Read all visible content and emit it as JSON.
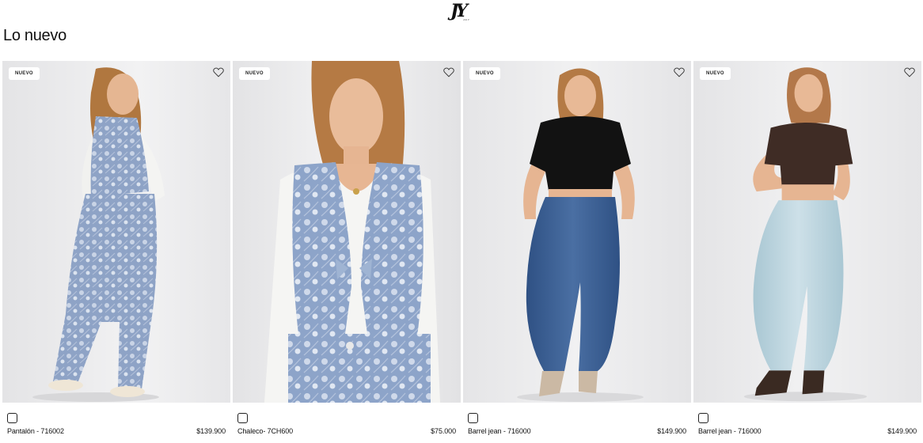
{
  "header": {
    "logo_text": "JY",
    "logo_sub": "JOY"
  },
  "section": {
    "title": "Lo nuevo"
  },
  "products": [
    {
      "badge": "NUEVO",
      "name": "Pantalón - 716002",
      "price": "$139.900"
    },
    {
      "badge": "NUEVO",
      "name": "Chaleco- 7CH600",
      "price": "$75.000"
    },
    {
      "badge": "NUEVO",
      "name": "Barrel jean - 716000",
      "price": "$149.900"
    },
    {
      "badge": "NUEVO",
      "name": "Barrel jean - 716000",
      "price": "$149.900"
    }
  ],
  "colors": {
    "photo_bg": "#e9e9ea",
    "floral_denim": "#8fa5c8",
    "dark_denim": "#3b5d8f",
    "light_denim": "#b9d3dc",
    "hair": "#b57a44",
    "skin": "#e7b894"
  }
}
